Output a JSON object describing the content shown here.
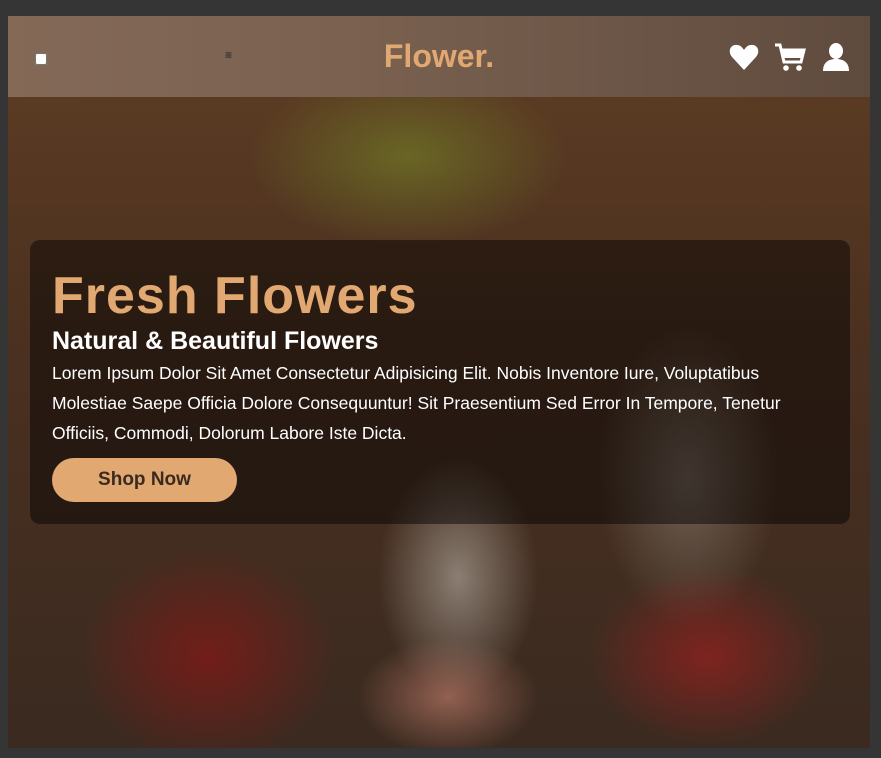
{
  "header": {
    "logo": "Flower.",
    "menu_icon": "≡",
    "icons": [
      "heart-icon",
      "cart-icon",
      "user-icon"
    ]
  },
  "hero": {
    "title": "Fresh Flowers",
    "subtitle": "Natural & Beautiful Flowers",
    "description": "Lorem Ipsum Dolor Sit Amet Consectetur Adipisicing Elit. Nobis Inventore Iure, Voluptatibus Molestiae Saepe Officia Dolore Consequuntur! Sit Praesentium Sed Error In Tempore, Tenetur Officiis, Commodi, Dolorum Labore Iste Dicta.",
    "button": "Shop Now"
  },
  "colors": {
    "accent": "#e2a872",
    "header": "#7a6150"
  }
}
